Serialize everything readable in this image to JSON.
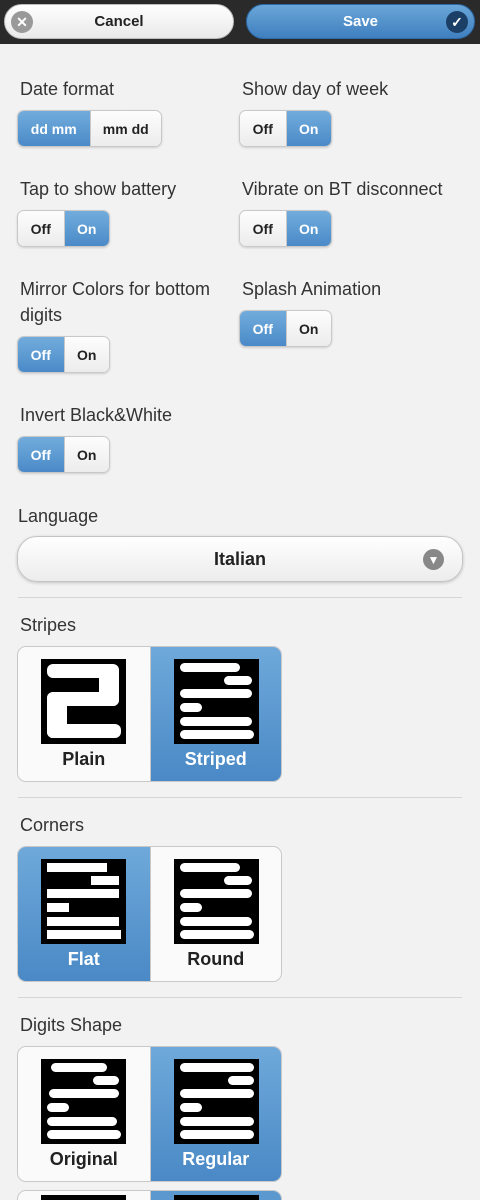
{
  "header": {
    "cancel_label": "Cancel",
    "save_label": "Save"
  },
  "settings": {
    "date_format": {
      "label": "Date format",
      "options": [
        "dd mm",
        "mm dd"
      ],
      "selected": "dd mm"
    },
    "show_day_of_week": {
      "label": "Show day of week",
      "options": [
        "Off",
        "On"
      ],
      "selected": "On"
    },
    "tap_battery": {
      "label": "Tap to show battery",
      "options": [
        "Off",
        "On"
      ],
      "selected": "On"
    },
    "vibrate_bt": {
      "label": "Vibrate on BT disconnect",
      "options": [
        "Off",
        "On"
      ],
      "selected": "On"
    },
    "mirror_colors": {
      "label": "Mirror Colors for bottom digits",
      "options": [
        "Off",
        "On"
      ],
      "selected": "Off"
    },
    "splash": {
      "label": "Splash Animation",
      "options": [
        "Off",
        "On"
      ],
      "selected": "Off"
    },
    "invert": {
      "label": "Invert Black&White",
      "options": [
        "Off",
        "On"
      ],
      "selected": "Off"
    }
  },
  "language": {
    "label": "Language",
    "value": "Italian"
  },
  "stripes": {
    "label": "Stripes",
    "options": [
      "Plain",
      "Striped"
    ],
    "selected": "Striped"
  },
  "corners": {
    "label": "Corners",
    "options": [
      "Flat",
      "Round"
    ],
    "selected": "Flat"
  },
  "digits_shape": {
    "label": "Digits Shape",
    "options": [
      "Original",
      "Regular"
    ],
    "selected": "Regular"
  },
  "colors": {
    "accent": "#4a8ac8",
    "header_bg": "#2a2a2a",
    "page_bg": "#f2f2f2"
  },
  "icons": {
    "cancel": "close-icon",
    "save": "check-icon",
    "language": "chevron-down-icon"
  }
}
